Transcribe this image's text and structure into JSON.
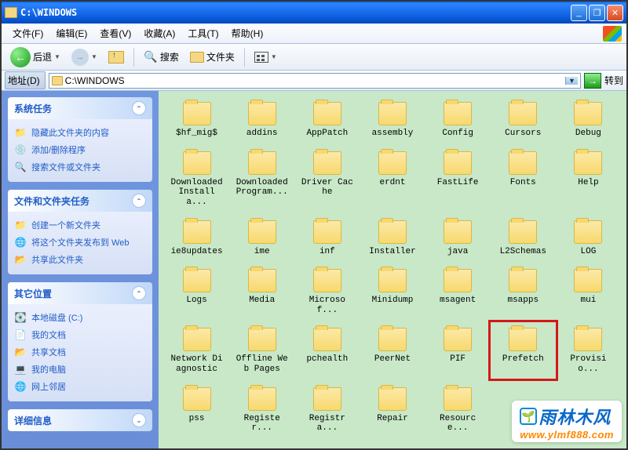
{
  "window": {
    "title": "C:\\WINDOWS",
    "min": "_",
    "max": "❐",
    "close": "✕"
  },
  "menu": [
    "文件(F)",
    "编辑(E)",
    "查看(V)",
    "收藏(A)",
    "工具(T)",
    "帮助(H)"
  ],
  "toolbar": {
    "back": "后退",
    "search": "搜索",
    "folders": "文件夹"
  },
  "address": {
    "label": "地址(D)",
    "path": "C:\\WINDOWS",
    "go": "转到",
    "arrow": "→"
  },
  "sidebar": {
    "p1": {
      "title": "系统任务",
      "items": [
        "隐藏此文件夹的内容",
        "添加/删除程序",
        "搜索文件或文件夹"
      ],
      "icons": [
        "📁",
        "💿",
        "🔍"
      ]
    },
    "p2": {
      "title": "文件和文件夹任务",
      "items": [
        "创建一个新文件夹",
        "将这个文件夹发布到 Web",
        "共享此文件夹"
      ],
      "icons": [
        "📁",
        "🌐",
        "📂"
      ]
    },
    "p3": {
      "title": "其它位置",
      "items": [
        "本地磁盘 (C:)",
        "我的文档",
        "共享文档",
        "我的电脑",
        "网上邻居"
      ],
      "icons": [
        "💽",
        "📄",
        "📂",
        "💻",
        "🌐"
      ]
    },
    "p4": {
      "title": "详细信息"
    }
  },
  "folders": [
    "$hf_mig$",
    "addins",
    "AppPatch",
    "assembly",
    "Config",
    "Cursors",
    "Debug",
    "Downloaded Installa...",
    "Downloaded Program...",
    "Driver Cache",
    "erdnt",
    "FastLife",
    "Fonts",
    "Help",
    "ie8updates",
    "ime",
    "inf",
    "Installer",
    "java",
    "L2Schemas",
    "LOG",
    "Logs",
    "Media",
    "Microsof...",
    "Minidump",
    "msagent",
    "msapps",
    "mui",
    "Network Diagnostic",
    "Offline Web Pages",
    "pchealth",
    "PeerNet",
    "PIF",
    "Prefetch",
    "Provisio...",
    "pss",
    "Register...",
    "Registra...",
    "Repair",
    "Resource..."
  ],
  "highlight_index": 33,
  "watermark": {
    "brand": "雨林木风",
    "url": "www.ylmf888.com",
    "logo": "🌱"
  }
}
